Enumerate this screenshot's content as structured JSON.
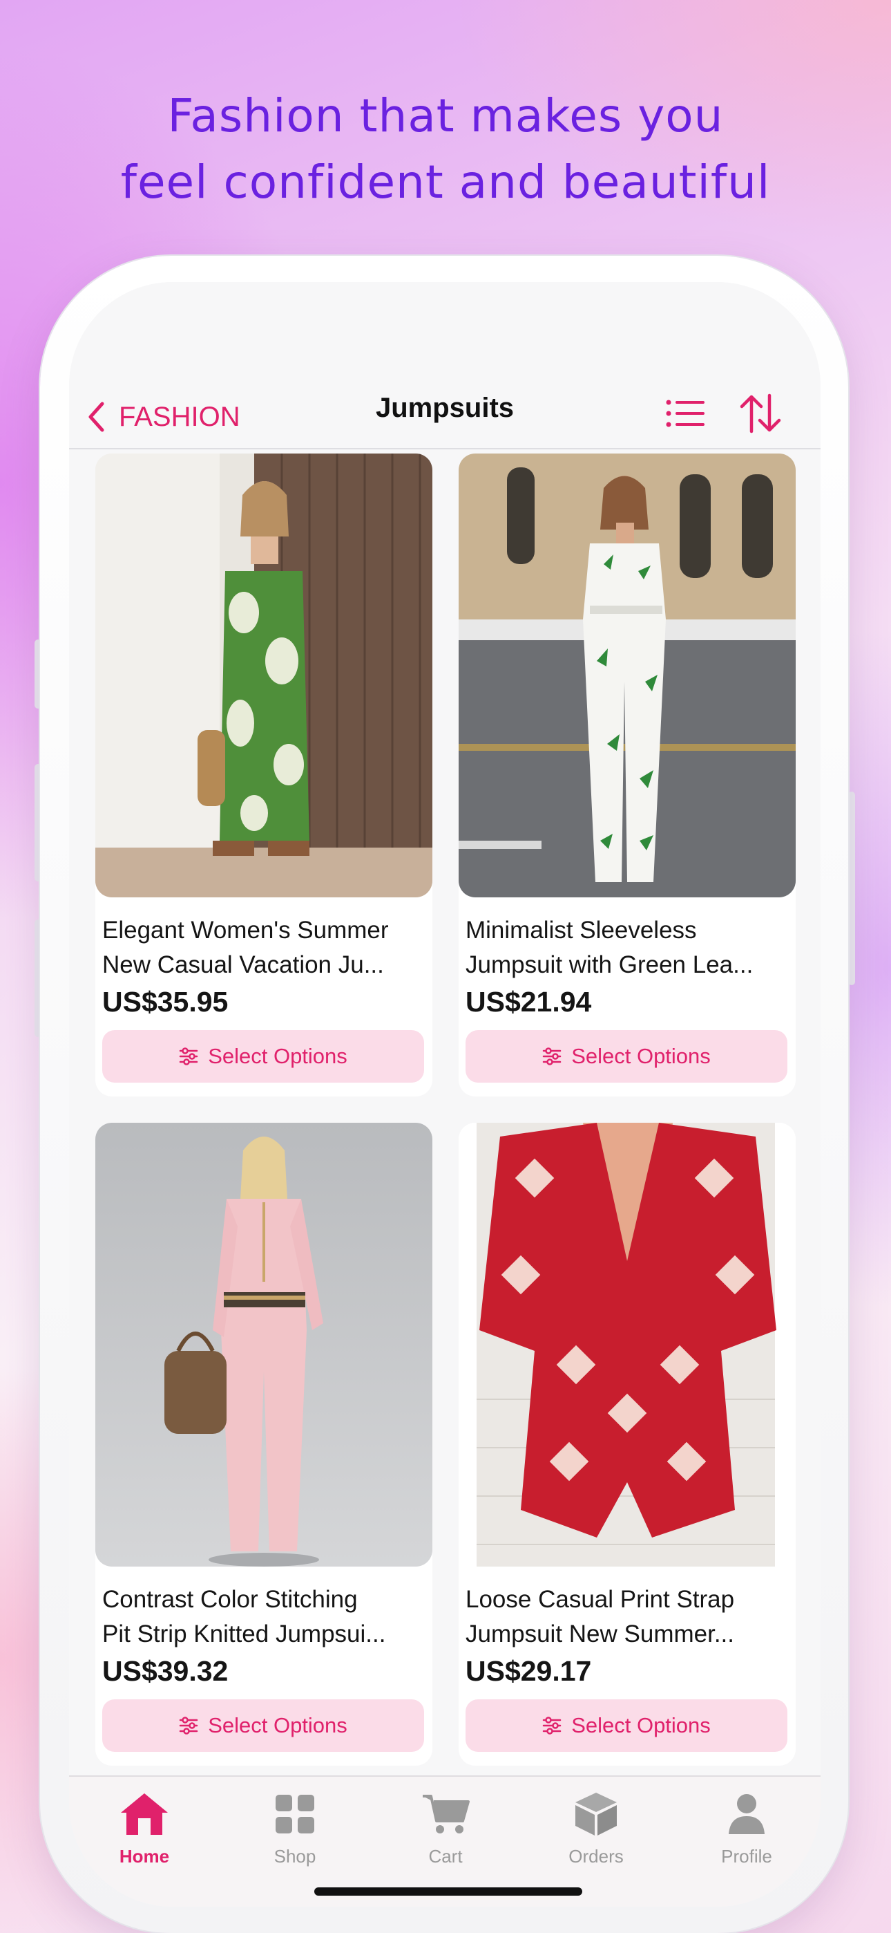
{
  "headline": {
    "line1": "Fashion that makes you",
    "line2": "feel confident and beautiful"
  },
  "navbar": {
    "back_label": "FASHION",
    "title": "Jumpsuits",
    "icons": [
      "chevron-left-icon",
      "list-icon",
      "sort-icon"
    ]
  },
  "products": [
    {
      "title_line1": "Elegant Women's Summer",
      "title_line2": "New Casual Vacation Ju...",
      "price": "US$35.95",
      "button_label": "Select Options"
    },
    {
      "title_line1": "Minimalist Sleeveless",
      "title_line2": "Jumpsuit with Green Lea...",
      "price": "US$21.94",
      "button_label": "Select Options"
    },
    {
      "title_line1": "Contrast Color Stitching",
      "title_line2": "Pit Strip Knitted Jumpsui...",
      "price": "US$39.32",
      "button_label": "Select Options"
    },
    {
      "title_line1": "Loose Casual Print Strap",
      "title_line2": "Jumpsuit New Summer...",
      "price": "US$29.17",
      "button_label": "Select Options"
    }
  ],
  "tabbar": {
    "items": [
      {
        "label": "Home",
        "icon": "home-icon",
        "active": true
      },
      {
        "label": "Shop",
        "icon": "grid-icon",
        "active": false
      },
      {
        "label": "Cart",
        "icon": "cart-icon",
        "active": false
      },
      {
        "label": "Orders",
        "icon": "box-icon",
        "active": false
      },
      {
        "label": "Profile",
        "icon": "person-icon",
        "active": false
      }
    ]
  },
  "colors": {
    "accent": "#e0216b",
    "headline": "#6a21e0",
    "button_bg": "#fbdce8",
    "inactive": "#9a9a9a"
  }
}
